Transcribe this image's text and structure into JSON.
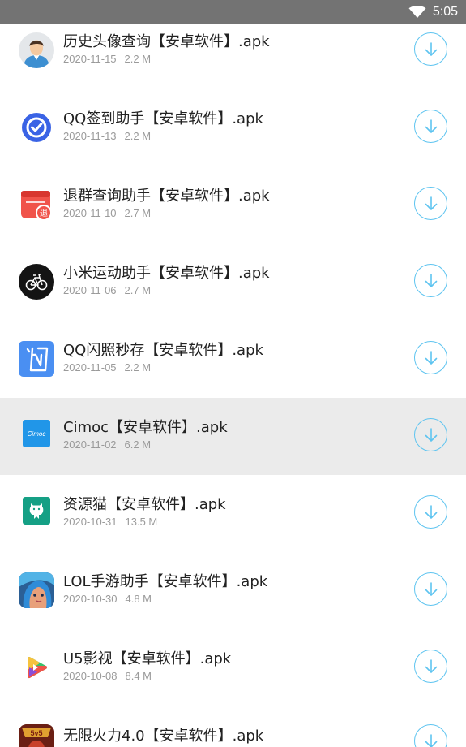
{
  "status_bar": {
    "time": "5:05",
    "wifi_icon": "wifi-icon"
  },
  "colors": {
    "accent": "#5ec4f0",
    "highlight_row": "#ebebeb",
    "status_bar": "#737373"
  },
  "files": [
    {
      "title": "历史头像查询【安卓软件】.apk",
      "date": "2020-11-15",
      "size": "2.2 M",
      "icon": "avatar-history-icon"
    },
    {
      "title": "QQ签到助手【安卓软件】.apk",
      "date": "2020-11-13",
      "size": "2.2 M",
      "icon": "qq-sign-in-icon"
    },
    {
      "title": "退群查询助手【安卓软件】.apk",
      "date": "2020-11-10",
      "size": "2.7 M",
      "icon": "quit-group-icon"
    },
    {
      "title": "小米运动助手【安卓软件】.apk",
      "date": "2020-11-06",
      "size": "2.7 M",
      "icon": "bicycle-icon"
    },
    {
      "title": "QQ闪照秒存【安卓软件】.apk",
      "date": "2020-11-05",
      "size": "2.2 M",
      "icon": "flash-photo-icon"
    },
    {
      "title": "Cimoc【安卓软件】.apk",
      "date": "2020-11-02",
      "size": "6.2 M",
      "icon": "cimoc-icon",
      "icon_text": "Cimoc",
      "highlighted": true
    },
    {
      "title": "资源猫【安卓软件】.apk",
      "date": "2020-10-31",
      "size": "13.5 M",
      "icon": "resource-cat-icon"
    },
    {
      "title": "LOL手游助手【安卓软件】.apk",
      "date": "2020-10-30",
      "size": "4.8 M",
      "icon": "lol-game-icon"
    },
    {
      "title": "U5影视【安卓软件】.apk",
      "date": "2020-10-08",
      "size": "8.4 M",
      "icon": "u5-video-icon"
    },
    {
      "title": "无限火力4.0【安卓软件】.apk",
      "date": "",
      "size": "",
      "icon": "urf-game-icon"
    }
  ]
}
